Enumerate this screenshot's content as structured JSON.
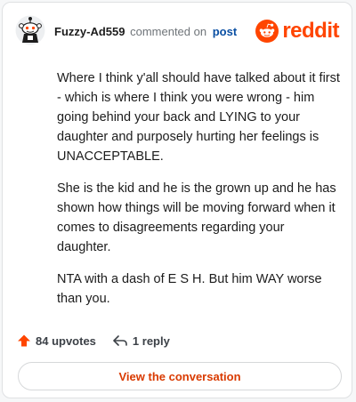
{
  "comment": {
    "username": "Fuzzy-Ad559",
    "action_text": "commented on",
    "post_link": "post",
    "paragraphs": [
      "Where I think y'all should have talked about it first - which is where I think you were wrong - him going behind your back and LYING to your daughter and purposely hurting her feelings is UNACCEPTABLE.",
      "She is the kid and he is the grown up and he has shown how things will be moving forward when it comes to disagreements regarding your daughter.",
      "NTA with a dash of E S H. But him WAY worse than you."
    ]
  },
  "brand": {
    "name": "reddit",
    "color": "#ff4500",
    "icon": "reddit-snoo-icon"
  },
  "stats": {
    "upvotes": "84 upvotes",
    "replies": "1 reply",
    "upvote_icon": "upvote-arrow-icon",
    "reply_icon": "reply-arrow-icon"
  },
  "actions": {
    "view_conversation": "View the conversation"
  },
  "colors": {
    "accent": "#ff4500",
    "cta_text": "#d93a00",
    "link": "#0a4fa3"
  }
}
